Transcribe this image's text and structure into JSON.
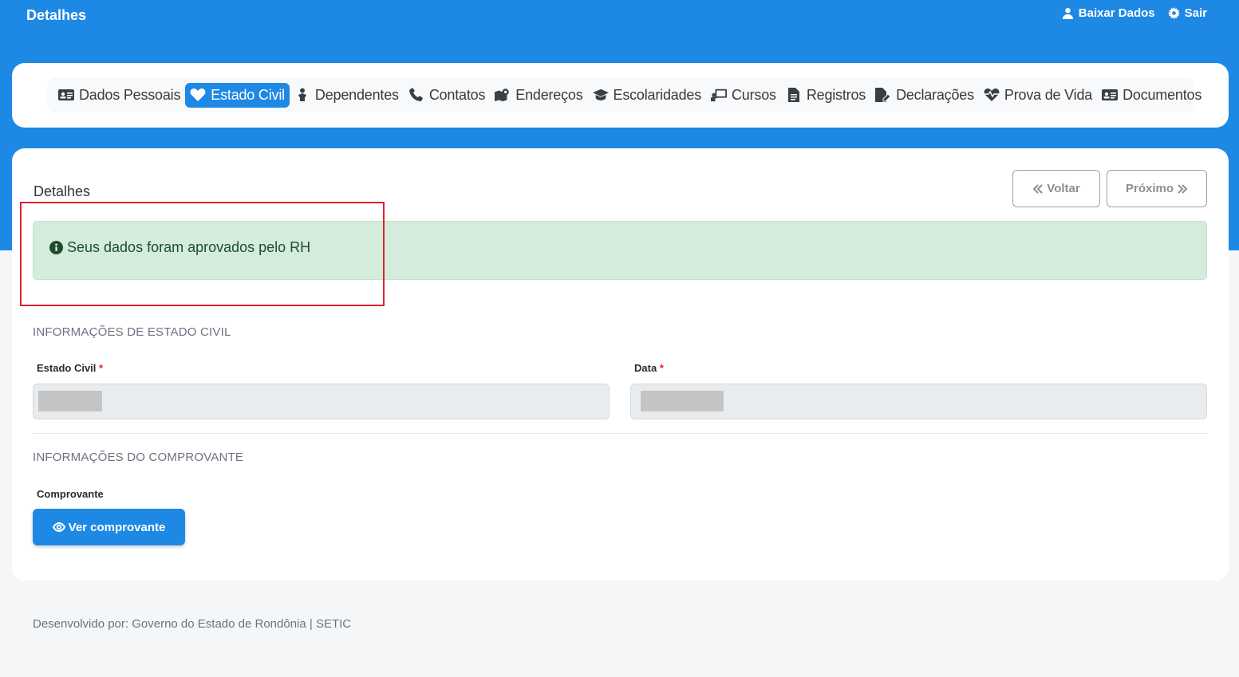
{
  "header": {
    "title": "Detalhes",
    "actions": [
      {
        "label": "Baixar Dados",
        "icon": "user-icon"
      },
      {
        "label": "Sair",
        "icon": "gear-icon"
      }
    ]
  },
  "nav": {
    "items": [
      {
        "label": "Dados Pessoais",
        "icon": "id-card-icon",
        "active": false
      },
      {
        "label": "Estado Civil",
        "icon": "heart-icon",
        "active": true
      },
      {
        "label": "Dependentes",
        "icon": "baby-icon",
        "active": false
      },
      {
        "label": "Contatos",
        "icon": "phone-icon",
        "active": false
      },
      {
        "label": "Endereços",
        "icon": "map-location-icon",
        "active": false
      },
      {
        "label": "Escolaridades",
        "icon": "graduation-cap-icon",
        "active": false
      },
      {
        "label": "Cursos",
        "icon": "chalkboard-teacher-icon",
        "active": false
      },
      {
        "label": "Registros",
        "icon": "file-icon",
        "active": false
      },
      {
        "label": "Declarações",
        "icon": "file-signature-icon",
        "active": false
      },
      {
        "label": "Prova de Vida",
        "icon": "heart-pulse-icon",
        "active": false
      },
      {
        "label": "Documentos",
        "icon": "id-card-icon",
        "active": false
      }
    ]
  },
  "card": {
    "title": "Detalhes",
    "back_label": "Voltar",
    "next_label": "Próximo"
  },
  "alert": {
    "icon": "info-circle-icon",
    "text": "Seus dados foram aprovados pelo RH"
  },
  "estado_section": {
    "heading": "INFORMAÇÕES DE ESTADO CIVIL",
    "estado_label": "Estado Civil",
    "data_label": "Data",
    "required_mark": "*"
  },
  "comprovante_section": {
    "heading": "INFORMAÇÕES DO COMPROVANTE",
    "label": "Comprovante",
    "button_label": "Ver comprovante"
  },
  "footer": {
    "text": "Desenvolvido por: Governo do Estado de Rondônia | SETIC"
  },
  "colors": {
    "primary": "#1e88e5",
    "alert_bg": "#d4ecdb",
    "alert_text": "#1e4d2b",
    "highlight": "#e2202c"
  }
}
